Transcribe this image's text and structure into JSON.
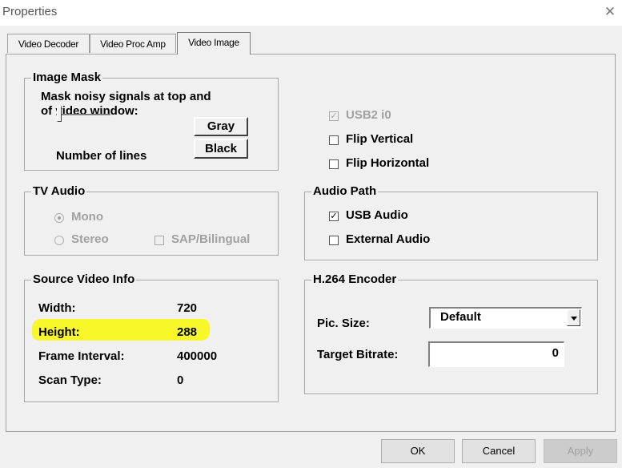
{
  "window": {
    "title": "Properties",
    "close_glyph": "✕"
  },
  "tabs": [
    {
      "label": "Video Decoder",
      "active": false
    },
    {
      "label": "Video Proc Amp",
      "active": false
    },
    {
      "label": "Video Image",
      "active": true
    }
  ],
  "image_mask": {
    "title": "Image Mask",
    "description_line1": "Mask noisy signals at top and",
    "description_line2": "of video window:",
    "gray_button": "Gray",
    "black_button": "Black",
    "slider_label": "Number of lines"
  },
  "options": {
    "usb2_i0": {
      "label": "USB2  i0",
      "checked": true,
      "disabled": true
    },
    "flip_vertical": {
      "label": "Flip Vertical",
      "checked": false
    },
    "flip_horizontal": {
      "label": "Flip Horizontal",
      "checked": false
    }
  },
  "tv_audio": {
    "title": "TV Audio",
    "mono": "Mono",
    "stereo": "Stereo",
    "sap": "SAP/Bilingual",
    "selected": "Mono",
    "disabled": true
  },
  "audio_path": {
    "title": "Audio Path",
    "usb_audio": {
      "label": "USB Audio",
      "checked": true
    },
    "external_audio": {
      "label": "External Audio",
      "checked": false
    }
  },
  "source_video_info": {
    "title": "Source Video Info",
    "rows": [
      {
        "label": "Width:",
        "value": "720"
      },
      {
        "label": "Height:",
        "value": "288",
        "highlighted": true
      },
      {
        "label": "Frame Interval:",
        "value": "400000"
      },
      {
        "label": "Scan Type:",
        "value": "0"
      }
    ]
  },
  "h264_encoder": {
    "title": "H.264 Encoder",
    "pic_size_label": "Pic. Size:",
    "pic_size_value": "Default",
    "target_bitrate_label": "Target Bitrate:",
    "target_bitrate_value": "0"
  },
  "buttons": {
    "ok": "OK",
    "cancel": "Cancel",
    "apply": "Apply"
  },
  "colors": {
    "highlight": "#f7f72a",
    "dialog_bg": "#f0f0f0",
    "disabled_text": "#a0a0a0"
  },
  "icons": {
    "check": "✓",
    "close": "close-icon",
    "dropdown": "chevron-down-icon"
  }
}
